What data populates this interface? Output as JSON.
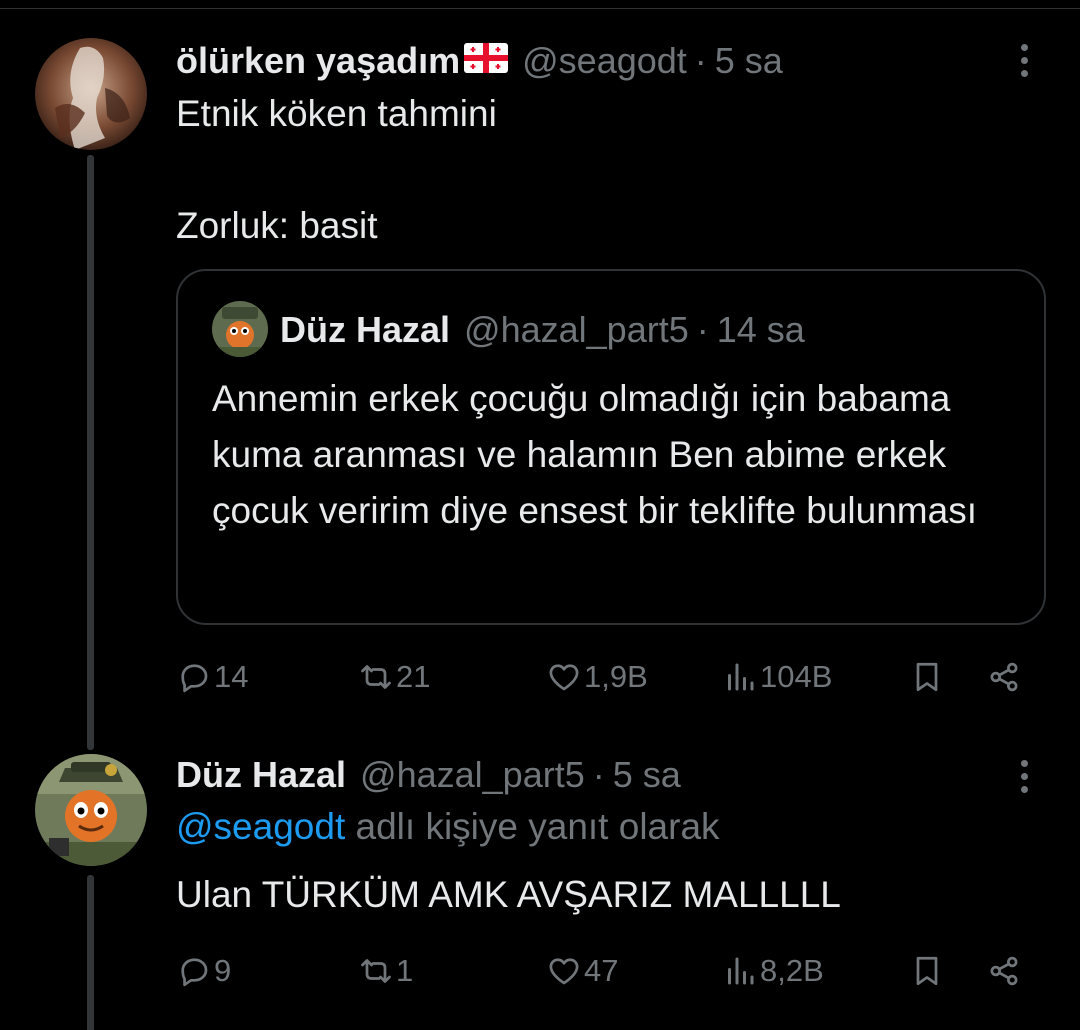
{
  "tweets": [
    {
      "display_name": "ölürken yaşadım",
      "flag_icon": "georgia-flag-icon",
      "handle": "@seagodt",
      "dot": "·",
      "time": "5 sa",
      "text": "Etnik köken tahmini\n\nZorluk: basit",
      "quote": {
        "display_name": "Düz Hazal",
        "handle": "@hazal_part5",
        "dot": "·",
        "time": "14 sa",
        "text": "Annemin erkek çocuğu olmadığı için babama kuma aranması ve halamın Ben abime erkek çocuk veririm diye ensest bir teklifte bulunması"
      },
      "actions": {
        "replies": "14",
        "retweets": "21",
        "likes": "1,9B",
        "views": "104B"
      }
    },
    {
      "display_name": "Düz Hazal",
      "handle": "@hazal_part5",
      "dot": "·",
      "time": "5 sa",
      "reply_mention": "@seagodt",
      "reply_suffix": " adlı kişiye yanıt olarak",
      "text": "Ulan TÜRKÜM AMK AVŞARIZ MALLLLL",
      "actions": {
        "replies": "9",
        "retweets": "1",
        "likes": "47",
        "views": "8,2B"
      }
    }
  ],
  "colors": {
    "background": "#000000",
    "text": "#e7e9ea",
    "muted": "#71767b",
    "link": "#1d9bf0",
    "border": "#2f3336"
  }
}
